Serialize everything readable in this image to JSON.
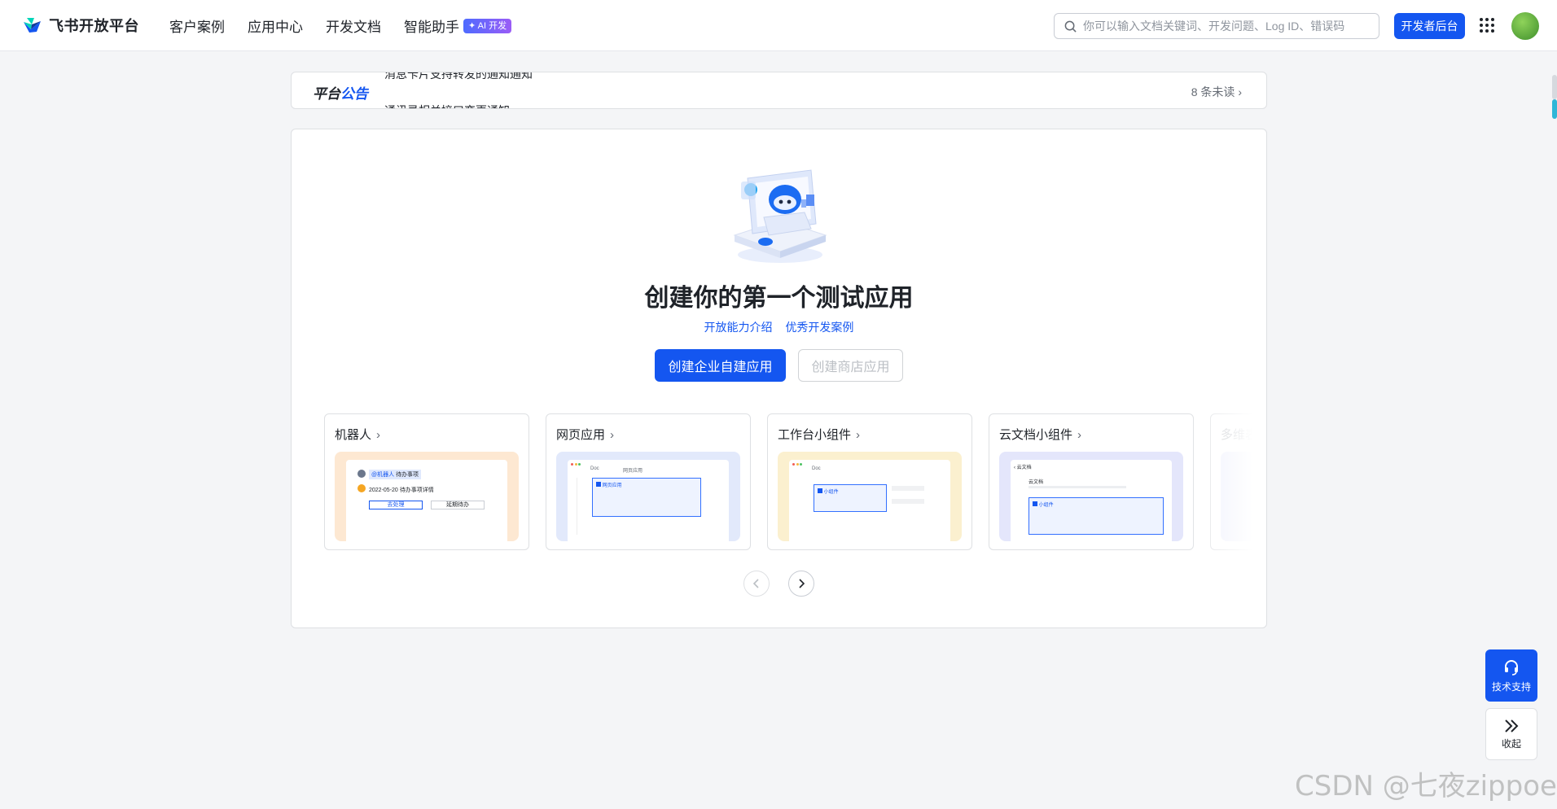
{
  "header": {
    "logo_text": "飞书开放平台",
    "nav": [
      {
        "label": "客户案例"
      },
      {
        "label": "应用中心"
      },
      {
        "label": "开发文档"
      },
      {
        "label": "智能助手",
        "badge": "✦ AI 开发"
      }
    ],
    "search_placeholder": "你可以输入文档关键词、开发问题、Log ID、错误码",
    "dev_console_label": "开发者后台"
  },
  "announcement": {
    "title_part1": "平台",
    "title_part2": "公告",
    "line1": "消息卡片支持转发的通知通知",
    "line2": "通讯录相关接口变更通知",
    "unread": "8 条未读"
  },
  "main": {
    "headline": "创建你的第一个测试应用",
    "link_capabilities": "开放能力介绍",
    "link_cases": "优秀开发案例",
    "create_enterprise_label": "创建企业自建应用",
    "create_store_label": "创建商店应用",
    "app_types": [
      {
        "label": "机器人",
        "color": "#fde8d2"
      },
      {
        "label": "网页应用",
        "color": "#e2e9fb"
      },
      {
        "label": "工作台小组件",
        "color": "#fbf0cf"
      },
      {
        "label": "云文档小组件",
        "color": "#e4e6fb"
      },
      {
        "label": "多维表格",
        "color": "#eef0fc"
      }
    ],
    "previews": {
      "bot_tag": "@机器人",
      "bot_title": "待办事项",
      "bot_text": "2022-05-20 待办事项详情",
      "bot_btn1": "去处理",
      "bot_btn2": "延期待办",
      "web_tab1": "Doc",
      "web_tab2": "网页应用",
      "web_panel": "网页应用",
      "wb_tab": "Doc",
      "wb_panel": "小组件",
      "doc_title": "云文档",
      "doc_heading": "云文档",
      "doc_panel": "小组件"
    }
  },
  "floating": {
    "support_label": "技术支持",
    "collapse_label": "收起"
  },
  "watermark": "CSDN @七夜zippoe"
}
